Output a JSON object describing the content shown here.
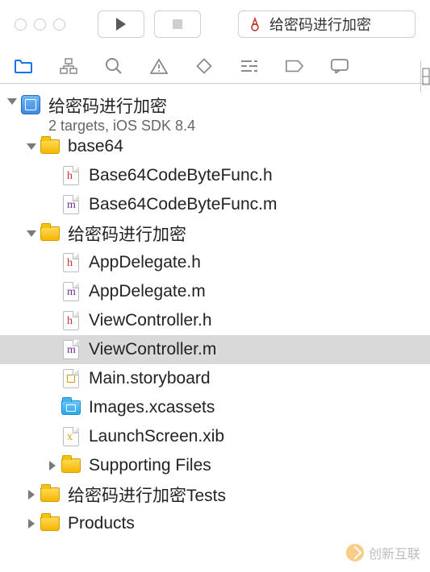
{
  "toolbar": {
    "scheme_label": "给密码进行加密"
  },
  "project": {
    "name": "给密码进行加密",
    "subtitle": "2 targets, iOS SDK 8.4"
  },
  "tree": {
    "base64": {
      "name": "base64",
      "files": {
        "f1": "Base64CodeByteFunc.h",
        "f2": "Base64CodeByteFunc.m"
      }
    },
    "main_group": {
      "name": "给密码进行加密",
      "files": {
        "appdelegate_h": "AppDelegate.h",
        "appdelegate_m": "AppDelegate.m",
        "vc_h": "ViewController.h",
        "vc_m": "ViewController.m",
        "storyboard": "Main.storyboard",
        "assets": "Images.xcassets",
        "launch": "LaunchScreen.xib"
      },
      "supporting": "Supporting Files"
    },
    "tests": "给密码进行加密Tests",
    "products": "Products"
  },
  "watermark": "创新互联"
}
